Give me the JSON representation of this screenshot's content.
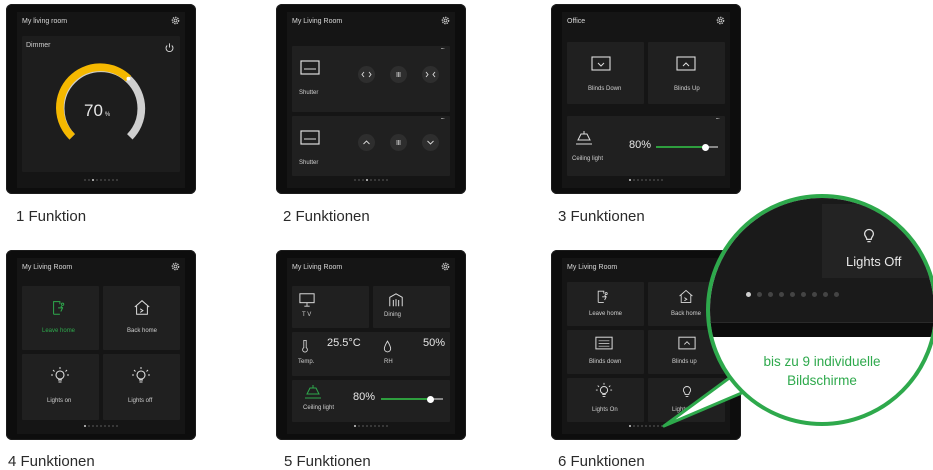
{
  "panels": [
    {
      "title": "My living room",
      "caption": "1 Funktion",
      "dimmer": {
        "label": "Dimmer",
        "value": "70",
        "unit": "%"
      },
      "active_dot": 2
    },
    {
      "title": "My Living Room",
      "caption": "2 Funktionen",
      "shutters": [
        {
          "label": "Shutter",
          "more": "..."
        },
        {
          "label": "Shutter",
          "more": "..."
        }
      ],
      "active_dot": 3
    },
    {
      "title": "Office",
      "caption": "3 Funktionen",
      "cards": [
        {
          "label": "Blinds Down",
          "icon": "blinds-down-icon"
        },
        {
          "label": "Blinds Up",
          "icon": "blinds-up-icon"
        }
      ],
      "light": {
        "label": "Ceiling light",
        "value": "80%",
        "level": 0.8,
        "more": "..."
      },
      "active_dot": 0
    },
    {
      "title": "My Living Room",
      "caption": "4 Funktionen",
      "cards": [
        {
          "label": "Leave home",
          "icon": "leave-home-icon",
          "active": true
        },
        {
          "label": "Back home",
          "icon": "back-home-icon"
        },
        {
          "label": "Lights on",
          "icon": "bulb-on-icon"
        },
        {
          "label": "Lights off",
          "icon": "bulb-on-icon"
        }
      ],
      "active_dot": 0
    },
    {
      "title": "My Living Room",
      "caption": "5 Funktionen",
      "cards": [
        {
          "label": "T V",
          "icon": "tv-icon"
        },
        {
          "label": "Dining",
          "icon": "dining-icon"
        }
      ],
      "temp": {
        "label": "Temp.",
        "value": "25.5°C"
      },
      "rh": {
        "label": "RH",
        "value": "50%"
      },
      "light": {
        "label": "Ceiling light",
        "value": "80%",
        "level": 0.8
      },
      "active_dot": 0
    },
    {
      "title": "My Living Room",
      "caption": "6 Funktionen",
      "cards": [
        {
          "label": "Leave home",
          "icon": "leave-home-icon"
        },
        {
          "label": "Back home",
          "icon": "back-home-icon"
        },
        {
          "label": "Blinds down",
          "icon": "blinds-down-icon"
        },
        {
          "label": "Blinds up",
          "icon": "blinds-up-icon"
        },
        {
          "label": "Lights On",
          "icon": "bulb-on-icon"
        },
        {
          "label": "Lights Off",
          "icon": "bulb-off-icon"
        }
      ],
      "active_dot": 0
    }
  ],
  "zoom": {
    "label": "Lights Off",
    "line1": "bis zu 9 individuelle",
    "line2": "Bildschirme",
    "active_dot": 0
  },
  "dot_count": 9,
  "colors": {
    "accent_green": "#2ea94c",
    "dimmer_yellow": "#f5b800",
    "screen_bg": "#151515"
  }
}
